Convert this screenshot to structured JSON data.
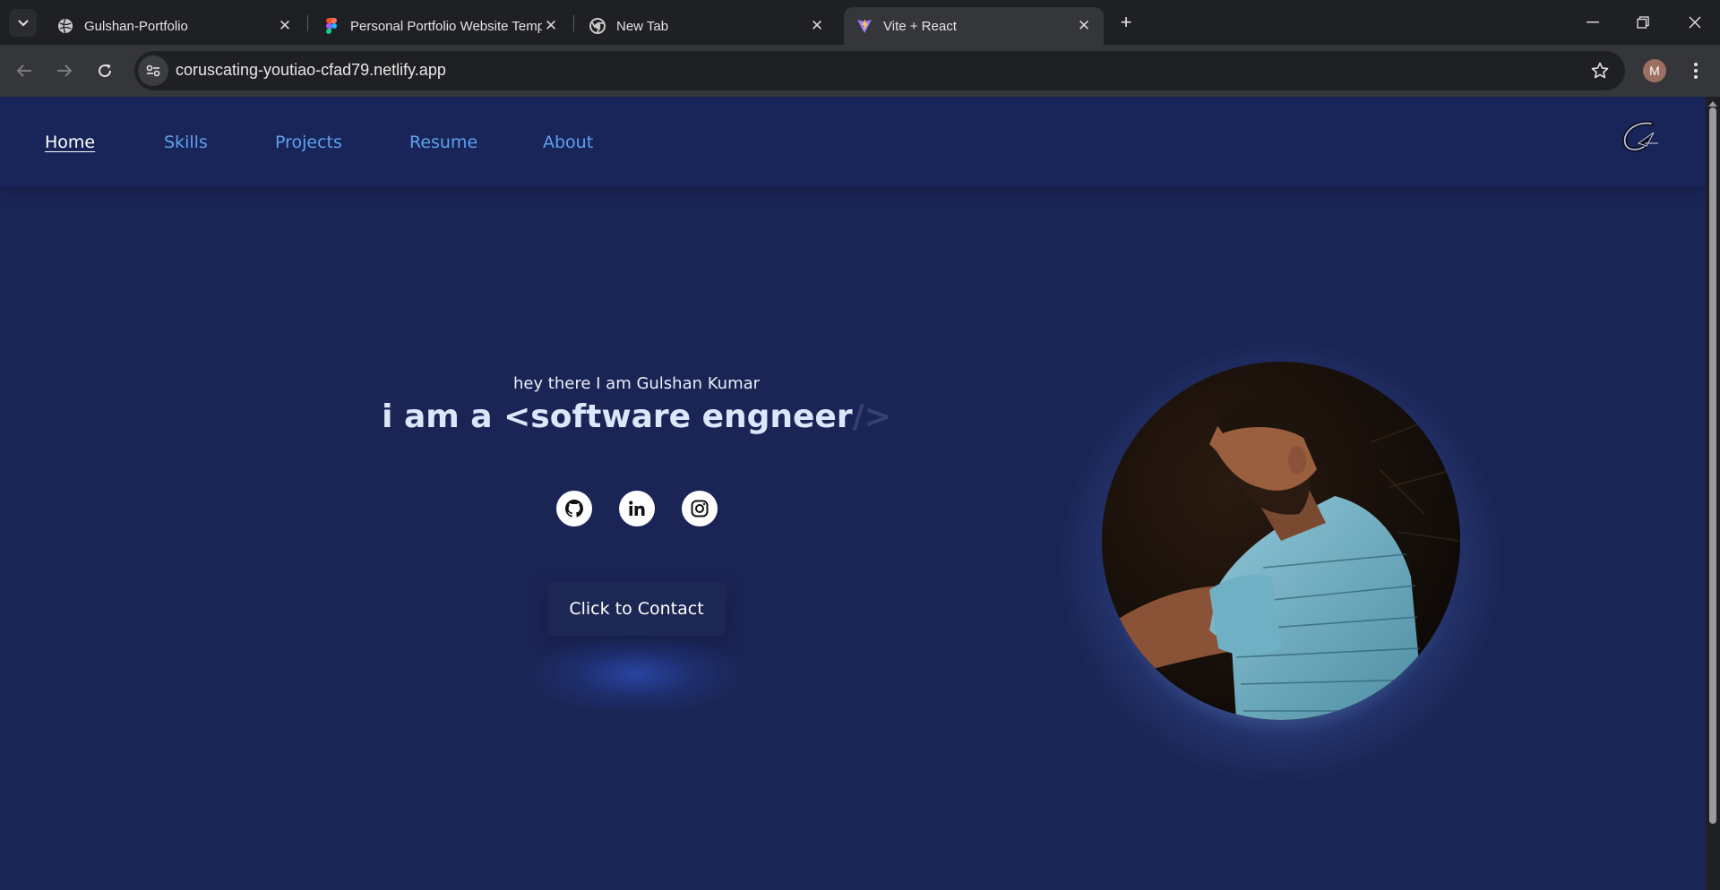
{
  "browser": {
    "tabs": [
      {
        "title": "Gulshan-Portfolio",
        "icon": "globe-icon",
        "active": false
      },
      {
        "title": "Personal Portfolio Website Temp",
        "icon": "figma-icon",
        "active": false
      },
      {
        "title": "New Tab",
        "icon": "chrome-icon",
        "active": false
      },
      {
        "title": "Vite + React",
        "icon": "vite-icon",
        "active": true
      }
    ],
    "url": "coruscating-youtiao-cfad79.netlify.app",
    "profile_initial": "M"
  },
  "page": {
    "nav": {
      "items": [
        "Home",
        "Skills",
        "Projects",
        "Resume",
        "About"
      ],
      "active": "Home"
    },
    "hero": {
      "greeting": "hey there I am Gulshan Kumar",
      "headline_prefix": "i am a ",
      "headline_typed": "<software engneer",
      "headline_cursor": "/>",
      "contact_button": "Click to Contact"
    },
    "social": [
      "github-icon",
      "linkedin-icon",
      "instagram-icon"
    ],
    "colors": {
      "page_bg": "#1b2555",
      "nav_link": "#5ea1ee",
      "headline": "#dbe8fb",
      "photo_glow": "#9ab9f5"
    }
  }
}
